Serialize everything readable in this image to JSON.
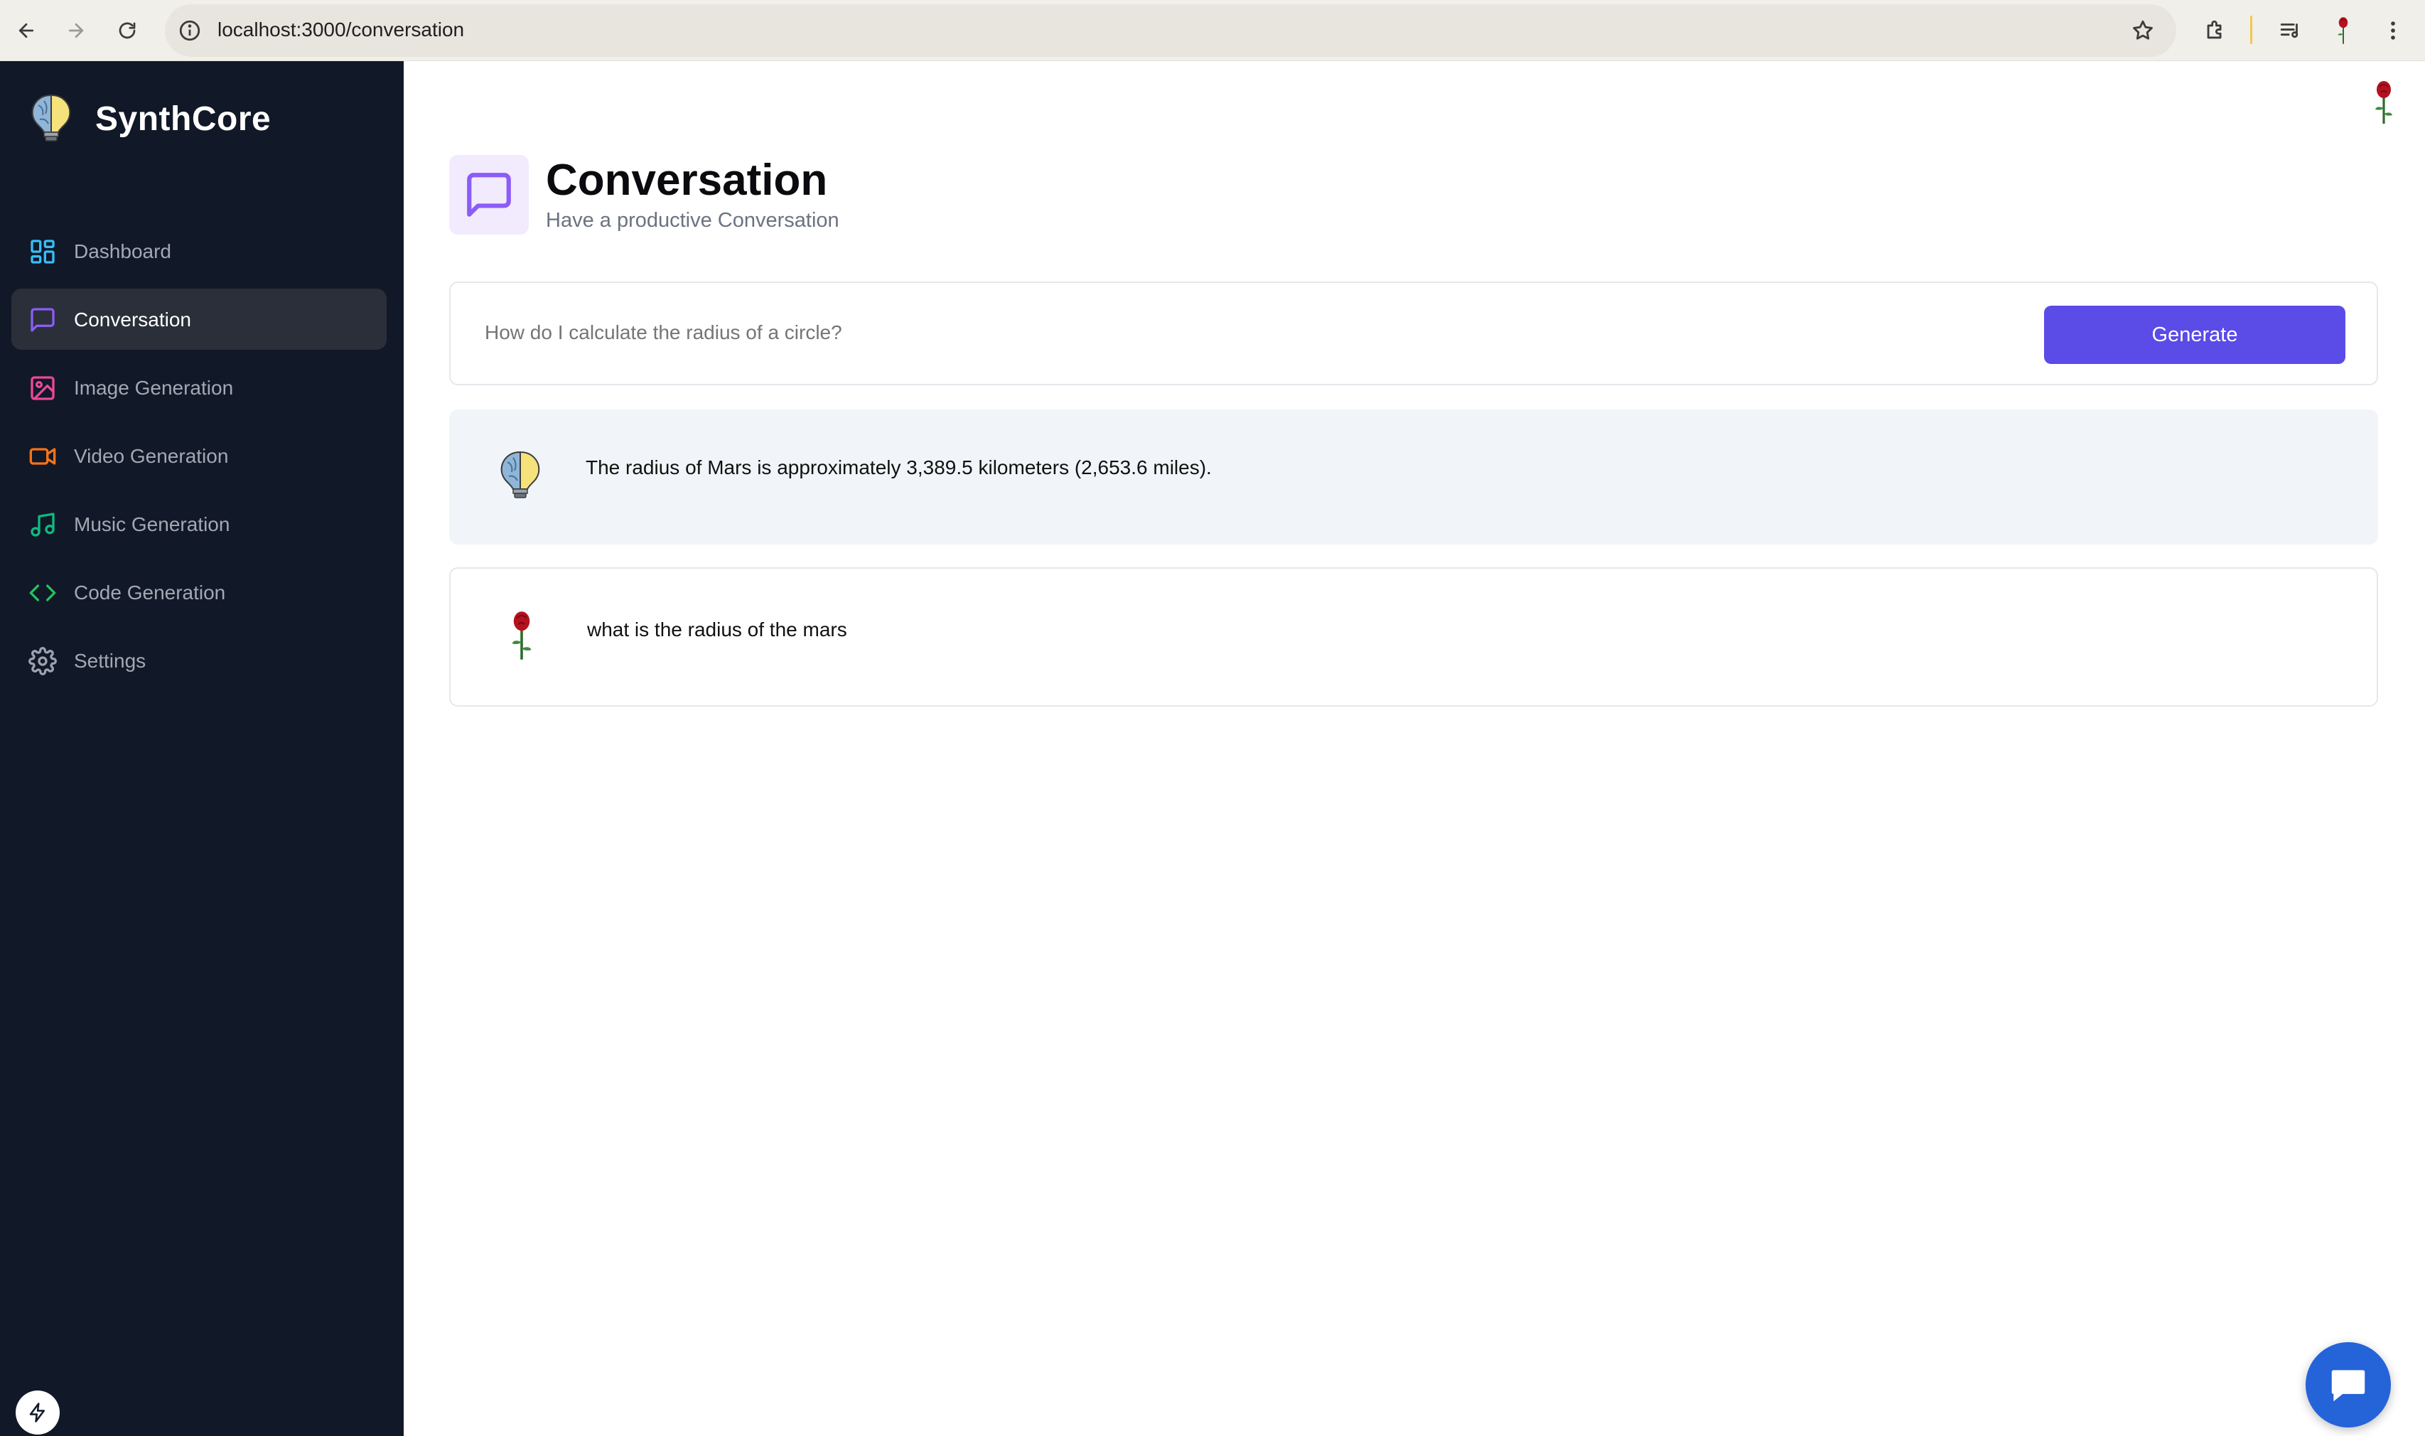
{
  "browser": {
    "url": "localhost:3000/conversation"
  },
  "sidebar": {
    "brand": "SynthCore",
    "items": [
      {
        "label": "Dashboard",
        "icon": "dashboard-icon",
        "color": "#38bdf8"
      },
      {
        "label": "Conversation",
        "icon": "message-square-icon",
        "color": "#8b5cf6",
        "active": true
      },
      {
        "label": "Image Generation",
        "icon": "image-icon",
        "color": "#ec4899"
      },
      {
        "label": "Video Generation",
        "icon": "video-icon",
        "color": "#f97316"
      },
      {
        "label": "Music Generation",
        "icon": "music-icon",
        "color": "#10b981"
      },
      {
        "label": "Code Generation",
        "icon": "code-icon",
        "color": "#22c55e"
      },
      {
        "label": "Settings",
        "icon": "settings-icon",
        "color": "#9ca3af"
      }
    ]
  },
  "header": {
    "title": "Conversation",
    "subtitle": "Have a productive Conversation",
    "icon": "message-square-icon",
    "accent": "#8b5cf6"
  },
  "prompt": {
    "placeholder": "How do I calculate the radius of a circle?",
    "button_label": "Generate",
    "button_color": "#5b4be7"
  },
  "messages": [
    {
      "role": "bot",
      "avatar": "lightbulb-logo-icon",
      "text": "The radius of Mars is approximately 3,389.5 kilometers (2,653.6 miles)."
    },
    {
      "role": "user",
      "avatar": "rose-avatar-icon",
      "text": "what is the radius of the mars"
    }
  ],
  "colors": {
    "sidebar_bg": "#111827",
    "bot_bubble": "#f1f5f9",
    "chat_fab": "#2563d9"
  }
}
